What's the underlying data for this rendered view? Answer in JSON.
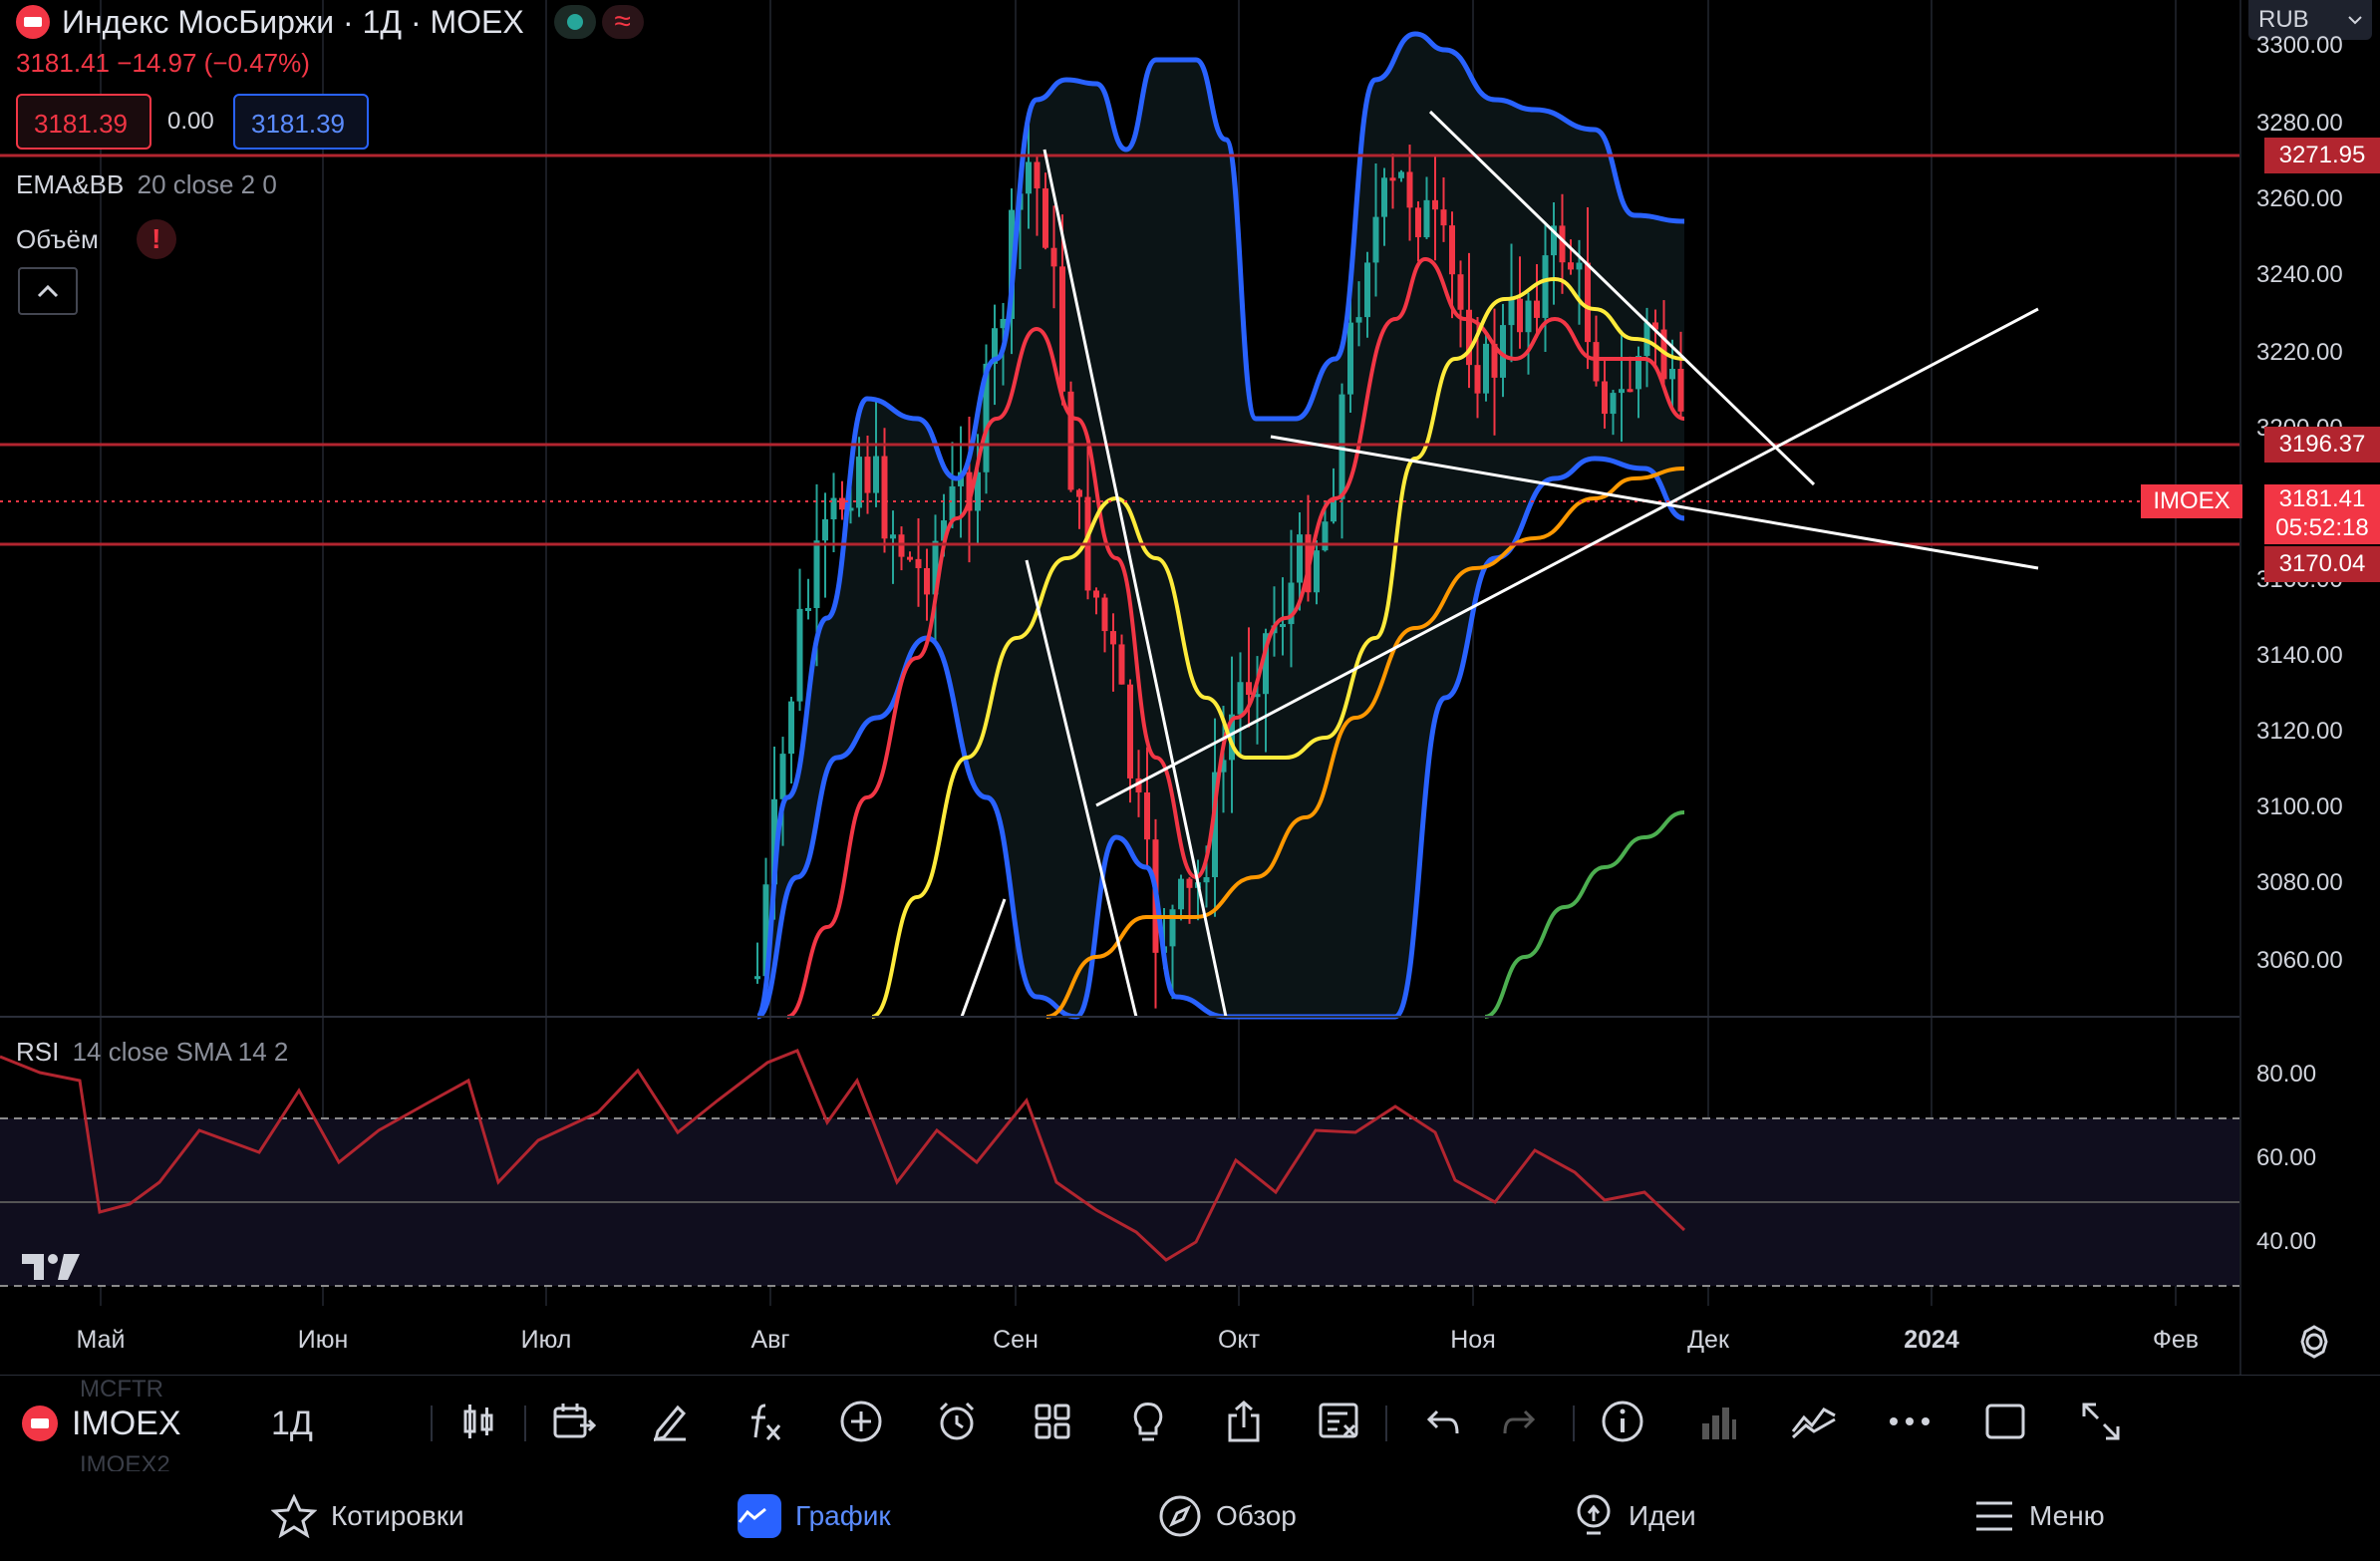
{
  "header": {
    "title": "Индекс МосБиржи · 1Д · MOEX",
    "quote": "3181.41 −14.97 (−0.47%)",
    "bid": "3181.39",
    "spread": "0.00",
    "ask": "3181.39",
    "currency": "RUB",
    "indicator_ema": "EMA&BB",
    "indicator_ema_params": "20 close 2 0",
    "indicator_volume": "Объём",
    "rsi_label": "RSI",
    "rsi_params": "14 close SMA 14 2"
  },
  "price_axis": {
    "labels": [
      "3300.00",
      "3280.00",
      "3260.00",
      "3240.00",
      "3220.00",
      "3200.00",
      "3160.00",
      "3140.00",
      "3120.00",
      "3100.00",
      "3080.00",
      "3060.00"
    ],
    "tag_high": "3271.95",
    "tag_mid": "3196.37",
    "tag_current": "3181.41",
    "tag_timer": "05:52:18",
    "tag_low": "3170.04",
    "symbol_tag": "IMOEX"
  },
  "rsi_axis": {
    "labels": [
      "80.00",
      "60.00",
      "40.00"
    ]
  },
  "time_axis": {
    "labels": [
      "Май",
      "Июн",
      "Июл",
      "Авг",
      "Сен",
      "Окт",
      "Ноя",
      "Дек",
      "2024",
      "Фев"
    ]
  },
  "toolbar": {
    "symbol": "IMOEX",
    "interval": "1Д",
    "ghost_top": "MCFTR",
    "ghost_bottom": "IMOEX2"
  },
  "nav": {
    "quotes": "Котировки",
    "chart": "График",
    "overview": "Обзор",
    "ideas": "Идеи",
    "menu": "Меню"
  },
  "colors": {
    "up": "#26a69a",
    "down": "#f23645",
    "bb": "#2962ff",
    "ema_yellow": "#ffeb3b",
    "ema_orange": "#ff9800",
    "ema_green": "#4caf50",
    "level": "#b2252f",
    "rsi": "#b2252f",
    "accent": "#2962ff"
  }
}
